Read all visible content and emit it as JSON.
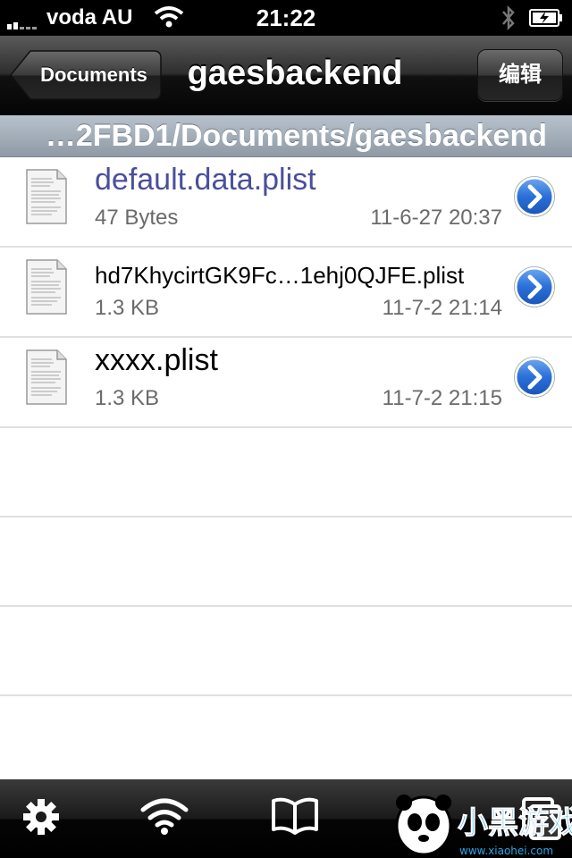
{
  "status_bar": {
    "carrier": "voda AU",
    "time": "21:22",
    "icons": [
      "signal-icon",
      "wifi-icon",
      "bluetooth-icon",
      "battery-charging-icon"
    ]
  },
  "nav": {
    "back_label": "Documents",
    "title": "gaesbackend",
    "edit_label": "编辑"
  },
  "path_bar": {
    "text": "…2FBD1/Documents/gaesbackend"
  },
  "files": [
    {
      "name": "default.data.plist",
      "size": "47 Bytes",
      "date": "11-6-27 20:37"
    },
    {
      "name": "hd7KhycirtGK9Fc…1ehj0QJFE.plist",
      "size": "1.3 KB",
      "date": "11-7-2 21:14"
    },
    {
      "name": "xxxx.plist",
      "size": "1.3 KB",
      "date": "11-7-2 21:15"
    }
  ],
  "tab_bar": {
    "items": [
      "gear-icon",
      "wifi-icon",
      "book-icon",
      "folder-icon",
      "copy-icon"
    ]
  },
  "watermark": {
    "text": "小黑游戏",
    "url_text": "www.xiaohei.com"
  },
  "colors": {
    "highlight_text": "#4a4f9c",
    "disclosure_blue": "#2a6fd8"
  }
}
